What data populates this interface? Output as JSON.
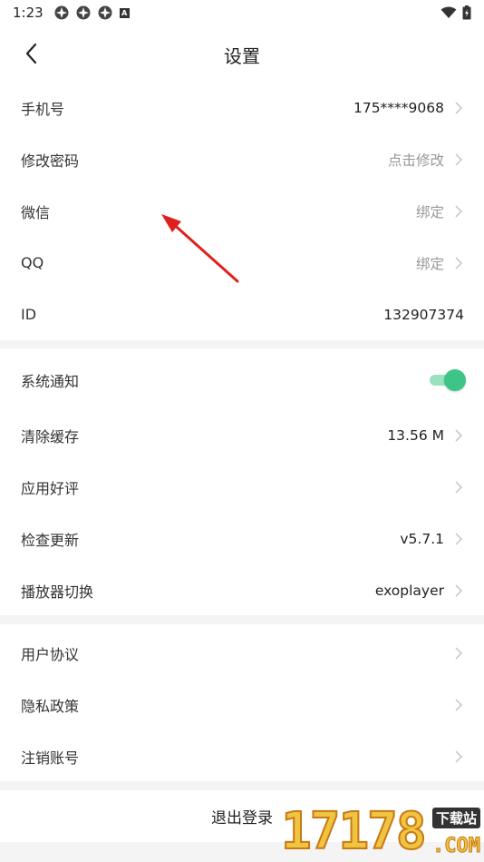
{
  "status_bar": {
    "time": "1:23",
    "notification_icons": [
      "pinwheel-icon",
      "pinwheel-icon",
      "pinwheel-icon",
      "a-badge-icon"
    ],
    "a_badge": "A",
    "right_icons": [
      "wifi-icon",
      "battery-charging-icon"
    ]
  },
  "header": {
    "title": "设置",
    "back_icon": "chevron-left-icon"
  },
  "account": {
    "phone_label": "手机号",
    "phone_value": "175****9068",
    "password_label": "修改密码",
    "password_value": "点击修改",
    "wechat_label": "微信",
    "wechat_value": "绑定",
    "qq_label": "QQ",
    "qq_value": "绑定",
    "id_label": "ID",
    "id_value": "132907374"
  },
  "preferences": {
    "notify_label": "系统通知",
    "notify_on": true,
    "cache_label": "清除缓存",
    "cache_value": "13.56 M",
    "rate_label": "应用好评",
    "update_label": "检查更新",
    "update_value": "v5.7.1",
    "player_label": "播放器切换",
    "player_value": "exoplayer"
  },
  "legal": {
    "agreement_label": "用户协议",
    "privacy_label": "隐私政策",
    "cancel_account_label": "注销账号"
  },
  "logout_label": "退出登录",
  "watermark": {
    "digits": "17178",
    "tag": "下载站",
    "domain": ".COM"
  },
  "colors": {
    "toggle_on": "#3cc587",
    "annotation_arrow": "#e0201c",
    "muted_text": "#999999"
  }
}
